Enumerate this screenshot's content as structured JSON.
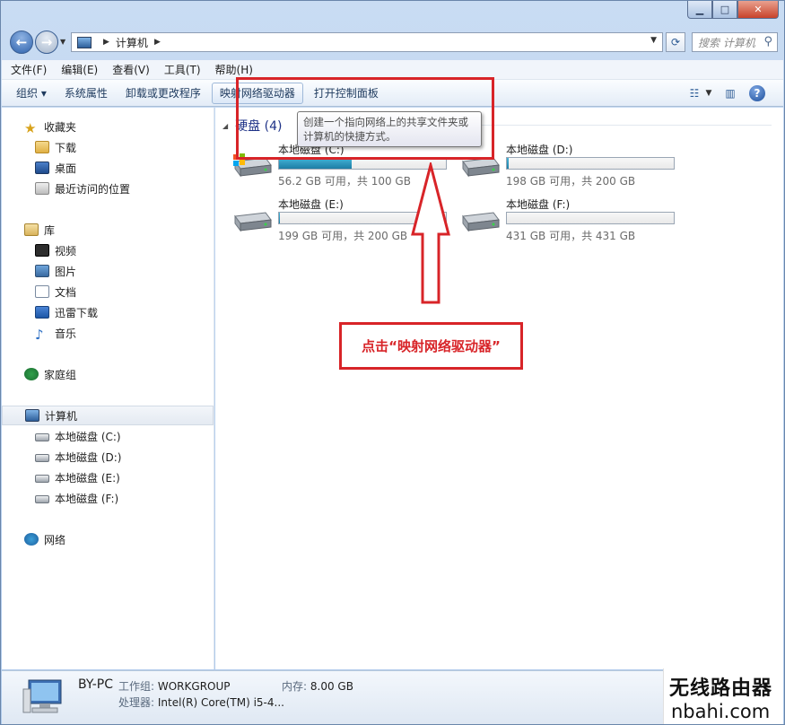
{
  "window": {
    "controls": {
      "minimize": "▁",
      "maximize": "□",
      "close": "✕"
    }
  },
  "navigation": {
    "back_icon": "back-arrow-icon",
    "forward_icon": "forward-arrow-icon",
    "breadcrumb": [
      "计算机"
    ],
    "search_placeholder": "搜索 计算机"
  },
  "menubar": {
    "items": [
      "文件(F)",
      "编辑(E)",
      "查看(V)",
      "工具(T)",
      "帮助(H)"
    ]
  },
  "toolbar": {
    "items": [
      "组织 ▾",
      "系统属性",
      "卸载或更改程序",
      "映射网络驱动器",
      "打开控制面板"
    ],
    "highlighted": "映射网络驱动器"
  },
  "tooltip": {
    "text": "创建一个指向网络上的共享文件夹或计算机的快捷方式。"
  },
  "sidebar": {
    "favorites": {
      "label": "收藏夹",
      "items": [
        "下载",
        "桌面",
        "最近访问的位置"
      ]
    },
    "libraries": {
      "label": "库",
      "items": [
        "视频",
        "图片",
        "文档",
        "迅雷下载",
        "音乐"
      ]
    },
    "homegroup": "家庭组",
    "computer": {
      "label": "计算机",
      "items": [
        "本地磁盘 (C:)",
        "本地磁盘 (D:)",
        "本地磁盘 (E:)",
        "本地磁盘 (F:)"
      ]
    },
    "network": "网络"
  },
  "content": {
    "group_title": "硬盘 (4)",
    "drives": [
      {
        "name": "本地磁盘 (C:)",
        "free": "56.2 GB 可用，共 100 GB",
        "used_fraction": 0.438
      },
      {
        "name": "本地磁盘 (D:)",
        "free": "198 GB 可用，共 200 GB",
        "used_fraction": 0.01
      },
      {
        "name": "本地磁盘 (E:)",
        "free": "199 GB 可用，共 200 GB",
        "used_fraction": 0.005
      },
      {
        "name": "本地磁盘 (F:)",
        "free": "431 GB 可用，共 431 GB",
        "used_fraction": 0.0
      }
    ]
  },
  "annotation": {
    "callout": "点击“映射网络驱动器”",
    "color": "#d82428"
  },
  "details": {
    "pc_name": "BY-PC",
    "workgroup_label": "工作组:",
    "workgroup": "WORKGROUP",
    "memory_label": "内存:",
    "memory": "8.00 GB",
    "processor_label": "处理器:",
    "processor": "Intel(R) Core(TM) i5-4..."
  },
  "watermark": {
    "line1": "无线路由器",
    "line2": "nbahi.com"
  }
}
